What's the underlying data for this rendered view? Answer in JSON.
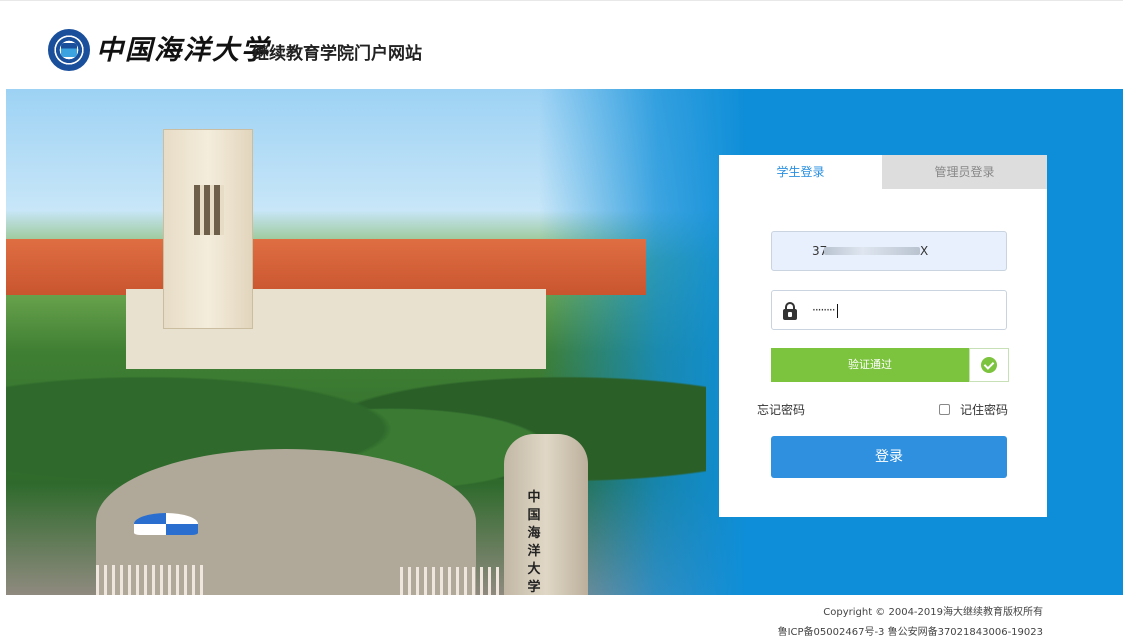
{
  "header": {
    "logo_name": "中国海洋大学",
    "site_title": "继续教育学院门户网站"
  },
  "hero": {
    "gate_text": "中国海洋大学"
  },
  "login": {
    "tabs": [
      {
        "label": "学生登录",
        "active": true
      },
      {
        "label": "管理员登录",
        "active": false
      }
    ],
    "username_prefix": "37",
    "username_suffix": "X",
    "password_mask": "········",
    "verify_label": "验证通过",
    "forgot_label": "忘记密码",
    "remember_label": "记住密码",
    "remember_checked": false,
    "login_label": "登录"
  },
  "footer": {
    "copyright": "Copyright © 2004-2019海大继续教育版权所有",
    "icp": "鲁ICP备05002467号-3    鲁公安网备37021843006-19023"
  },
  "colors": {
    "accent": "#2f90e0",
    "hero_blue": "#0e8ed8",
    "verify_green": "#7cc33e"
  }
}
